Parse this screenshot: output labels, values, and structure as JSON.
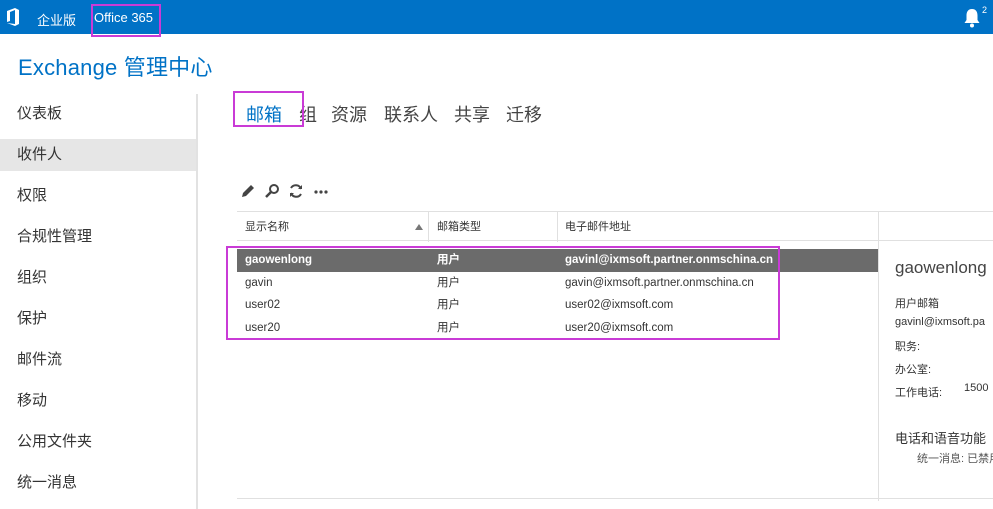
{
  "topbar": {
    "brand": "企业版",
    "office": "Office 365",
    "notification_count": "2",
    "bg_color": "#0072c6"
  },
  "page": {
    "title": "Exchange 管理中心"
  },
  "sidebar": {
    "items": [
      {
        "label": "仪表板",
        "active": false
      },
      {
        "label": "收件人",
        "active": true
      },
      {
        "label": "权限",
        "active": false
      },
      {
        "label": "合规性管理",
        "active": false
      },
      {
        "label": "组织",
        "active": false
      },
      {
        "label": "保护",
        "active": false
      },
      {
        "label": "邮件流",
        "active": false
      },
      {
        "label": "移动",
        "active": false
      },
      {
        "label": "公用文件夹",
        "active": false
      },
      {
        "label": "统一消息",
        "active": false
      }
    ]
  },
  "tabs": [
    {
      "label": "邮箱",
      "active": true
    },
    {
      "label": "组",
      "active": false
    },
    {
      "label": "资源",
      "active": false
    },
    {
      "label": "联系人",
      "active": false
    },
    {
      "label": "共享",
      "active": false
    },
    {
      "label": "迁移",
      "active": false
    }
  ],
  "toolbar": {
    "icons": [
      "edit-icon",
      "search-icon",
      "refresh-icon",
      "more-icon"
    ]
  },
  "table": {
    "columns": [
      "显示名称",
      "邮箱类型",
      "电子邮件地址"
    ],
    "rows": [
      {
        "name": "gaowenlong",
        "type": "用户",
        "email": "gavinl@ixmsoft.partner.onmschina.cn",
        "selected": true
      },
      {
        "name": "gavin",
        "type": "用户",
        "email": "gavin@ixmsoft.partner.onmschina.cn",
        "selected": false
      },
      {
        "name": "user02",
        "type": "用户",
        "email": "user02@ixmsoft.com",
        "selected": false
      },
      {
        "name": "user20",
        "type": "用户",
        "email": "user20@ixmsoft.com",
        "selected": false
      }
    ]
  },
  "detail": {
    "name": "gaowenlong",
    "mailbox_label": "用户邮箱",
    "email": "gavinl@ixmsoft.pa",
    "title_label": "职务:",
    "office_label": "办公室:",
    "phone_label": "工作电话:",
    "phone_value": "1500",
    "voice_section": "电话和语音功能",
    "voice_status": "统一消息: 已禁用"
  },
  "colors": {
    "accent": "#0072c6",
    "highlight_box": "#c93bd6",
    "selected_row": "#6b6b6b"
  }
}
